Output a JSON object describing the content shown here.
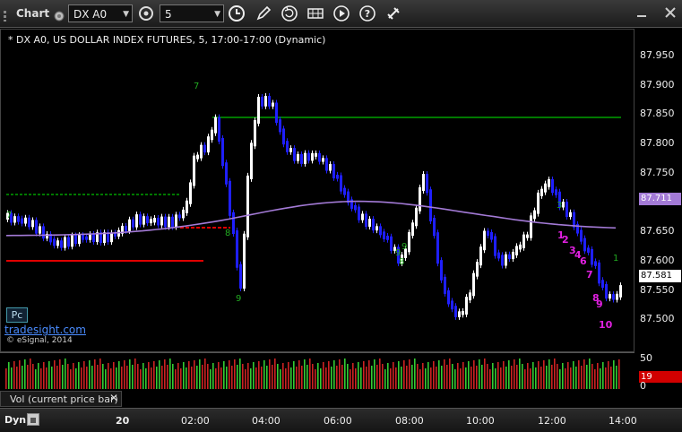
{
  "window": {
    "title": "Chart"
  },
  "toolbar": {
    "symbol": "DX A0",
    "interval": "5",
    "icons": [
      "chart-settings-icon",
      "clock-icon",
      "pencil-icon",
      "refresh-icon",
      "grid-icon",
      "play-icon",
      "help-icon",
      "link-icon"
    ]
  },
  "chart": {
    "title": "* DX A0, US DOLLAR INDEX FUTURES, 5, 17:00-17:00 (Dynamic)",
    "price_ticks": [
      "87.950",
      "87.900",
      "87.850",
      "87.800",
      "87.750",
      "87.700",
      "87.650",
      "87.600",
      "87.550",
      "87.500"
    ],
    "ma_tag": "87.711",
    "price_tag": "87.581",
    "watermark": {
      "pc": "Pc",
      "site": "tradesight.com",
      "credit": "© eSignal, 2014"
    },
    "colors": {
      "up_bar": "#ffffff",
      "down_bar": "#1f1fff",
      "ma": "#a37ad6",
      "green_level": "#00aa00",
      "red_level": "#e00000",
      "count_green": "#22aa22",
      "count_magenta": "#e020e0"
    }
  },
  "volume": {
    "label": "Vol (current price bar)",
    "ticks": [
      "50",
      "0"
    ],
    "value_tag": "19"
  },
  "time_axis": {
    "mode": "Dyn",
    "labels": [
      "20",
      "02:00",
      "04:00",
      "06:00",
      "08:00",
      "10:00",
      "12:00",
      "14:00"
    ]
  }
}
